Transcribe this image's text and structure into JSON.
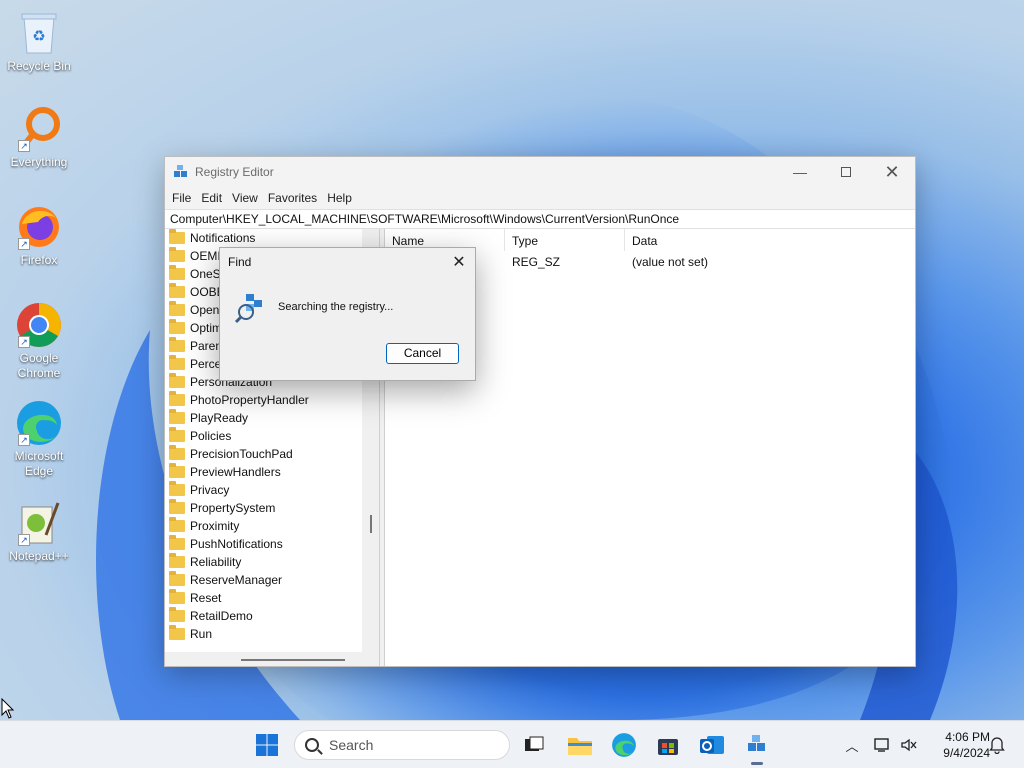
{
  "desktop": {
    "icons": [
      {
        "label": "Recycle Bin"
      },
      {
        "label": "Everything"
      },
      {
        "label": "Firefox"
      },
      {
        "label": "Google Chrome"
      },
      {
        "label": "Microsoft Edge"
      },
      {
        "label": "Notepad++"
      }
    ]
  },
  "window": {
    "title": "Registry Editor",
    "menu": [
      "File",
      "Edit",
      "View",
      "Favorites",
      "Help"
    ],
    "address": "Computer\\HKEY_LOCAL_MACHINE\\SOFTWARE\\Microsoft\\Windows\\CurrentVersion\\RunOnce",
    "tree": [
      "Notifications",
      "OEMInformation",
      "OneSettings",
      "OOBE",
      "OpenWith",
      "OptimalLayout",
      "Parental Controls",
      "PerceptionSimulationExtensions",
      "Personalization",
      "PhotoPropertyHandler",
      "PlayReady",
      "Policies",
      "PrecisionTouchPad",
      "PreviewHandlers",
      "Privacy",
      "PropertySystem",
      "Proximity",
      "PushNotifications",
      "Reliability",
      "ReserveManager",
      "Reset",
      "RetailDemo",
      "Run"
    ],
    "columns": {
      "name": "Name",
      "type": "Type",
      "data": "Data"
    },
    "rows": [
      {
        "name": "",
        "type": "REG_SZ",
        "data": "(value not set)"
      }
    ]
  },
  "find_dialog": {
    "title": "Find",
    "message": "Searching the registry...",
    "cancel_label": "Cancel"
  },
  "taskbar": {
    "search_placeholder": "Search",
    "time": "4:06 PM",
    "date": "9/4/2024"
  },
  "colors": {
    "accent": "#0067c0",
    "folder": "#f2c648",
    "taskbar": "#eef1f5"
  }
}
